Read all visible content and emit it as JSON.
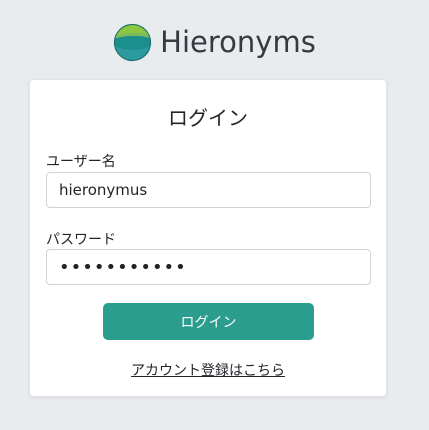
{
  "brand": {
    "name": "Hieronyms",
    "logo_icon": "globe-logo-icon",
    "colors": {
      "top": "#8dc63f",
      "middle": "#1a8f8c",
      "bottom": "#2c9a9e"
    }
  },
  "login_form": {
    "title": "ログイン",
    "username_label": "ユーザー名",
    "username_value": "hieronymus",
    "password_label": "パスワード",
    "password_value": "hieronymus1",
    "submit_label": "ログイン",
    "register_link": "アカウント登録はこちら"
  },
  "colors": {
    "page_background": "#e9ecef",
    "button_accent": "#2a9d8f"
  }
}
